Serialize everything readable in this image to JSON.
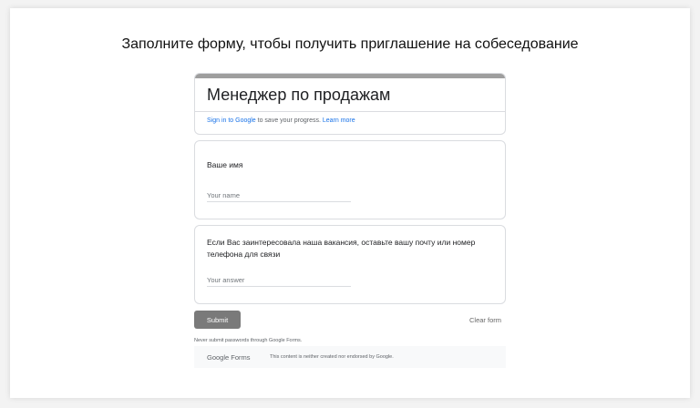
{
  "page": {
    "heading": "Заполните форму, чтобы получить приглашение на собеседование"
  },
  "form": {
    "title": "Менеджер по продажам",
    "signin_link": "Sign in to Google",
    "signin_text": " to save your progress. ",
    "learn_more": "Learn more",
    "accent_color": "#9e9e9e"
  },
  "questions": [
    {
      "label": "Ваше имя",
      "placeholder": "Your name"
    },
    {
      "label": "Если Вас заинтересовала наша вакансия, оставьте вашу почту или номер телефона для связи",
      "placeholder": "Your answer"
    }
  ],
  "actions": {
    "submit": "Submit",
    "clear": "Clear form"
  },
  "warning": "Never submit passwords through Google Forms.",
  "footer": {
    "logo_google": "Google",
    "logo_forms": " Forms",
    "note": "This content is neither created nor endorsed by Google."
  }
}
